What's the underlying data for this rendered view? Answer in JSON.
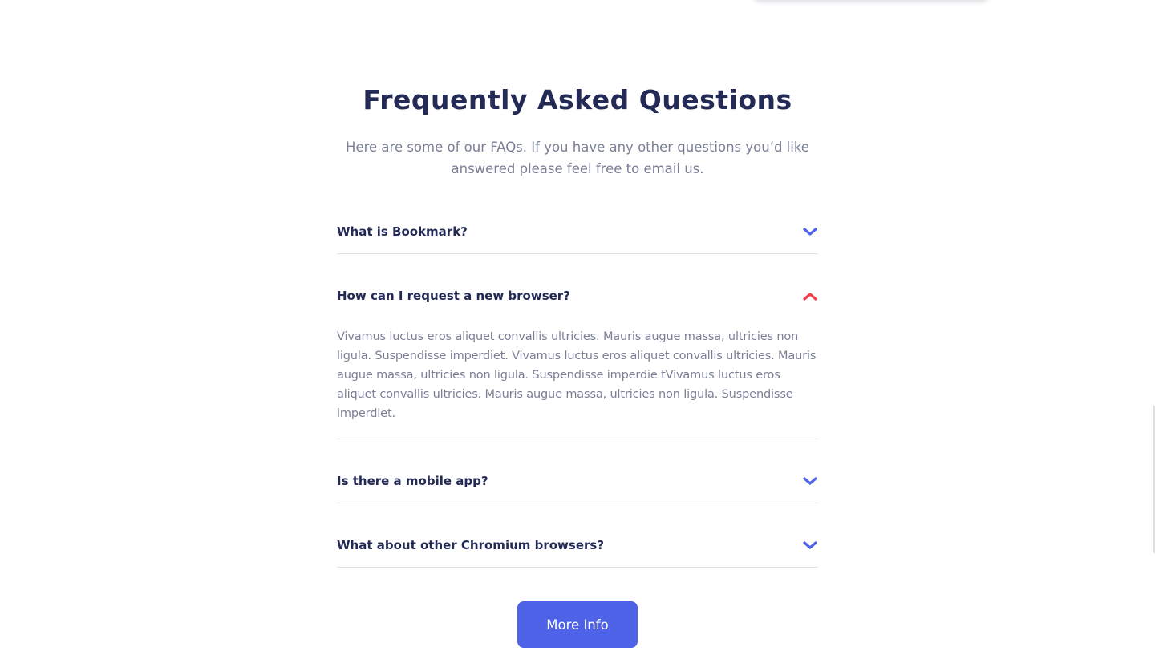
{
  "faq_section": {
    "title": "Frequently Asked Questions",
    "subtitle": "Here are some of our FAQs. If you have any other questions you’d like answered please feel free to email us.",
    "items": [
      {
        "question": "What is Bookmark?",
        "expanded": false,
        "icon": "chevron-down-icon"
      },
      {
        "question": "How can I request a new browser?",
        "expanded": true,
        "icon": "chevron-up-icon",
        "answer": "Vivamus luctus eros aliquet convallis ultricies. Mauris augue massa, ultricies non ligula. Suspendisse imperdiet. Vivamus luctus eros aliquet convallis ultricies. Mauris augue massa, ultricies non ligula. Suspendisse imperdie tVivamus luctus eros aliquet convallis ultricies. Mauris augue massa, ultricies non ligula. Suspendisse imperdiet."
      },
      {
        "question": "Is there a mobile app?",
        "expanded": false,
        "icon": "chevron-down-icon"
      },
      {
        "question": "What about other Chromium browsers?",
        "expanded": false,
        "icon": "chevron-down-icon"
      }
    ],
    "more_button_label": "More Info"
  },
  "colors": {
    "heading": "#242a56",
    "body_text": "#7a7f96",
    "accent_blue": "#4e63e8",
    "accent_red": "#f0404b",
    "divider": "#dde0e8"
  }
}
